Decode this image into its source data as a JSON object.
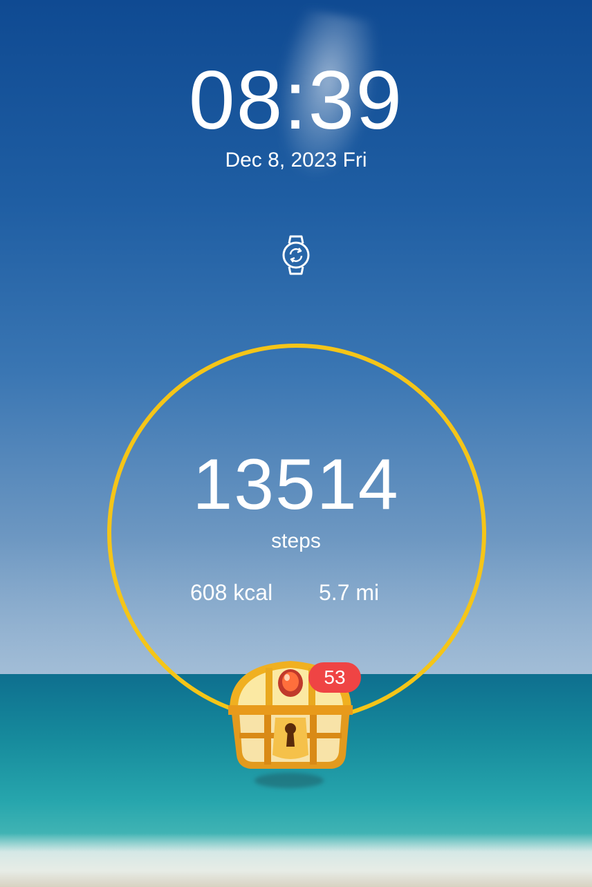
{
  "lockscreen": {
    "time": "08:39",
    "date": "Dec 8, 2023 Fri"
  },
  "watch_sync": {
    "icon": "watch-sync-icon"
  },
  "activity": {
    "steps_value": "13514",
    "steps_label": "steps",
    "calories": "608 kcal",
    "distance": "5.7 mi",
    "ring_color": "#f5c518"
  },
  "reward": {
    "icon": "treasure-chest-icon",
    "badge_count": "53",
    "badge_color": "#ef4444"
  }
}
